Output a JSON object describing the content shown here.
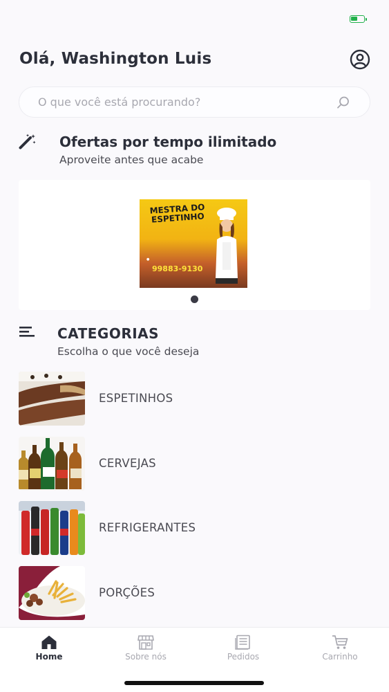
{
  "header": {
    "greeting": "Olá, Washington Luis"
  },
  "search": {
    "placeholder": "O que você está procurando?",
    "value": ""
  },
  "offers": {
    "title": "Ofertas por tempo ilimitado",
    "subtitle": "Aproveite antes que acabe",
    "banner": {
      "brand": "MESTRA DO ESPETINHO",
      "phone": "99883-9130"
    },
    "carousel_index": 1,
    "carousel_total": 1
  },
  "categories": {
    "title": "CATEGORIAS",
    "subtitle": "Escolha o que você deseja",
    "items": [
      {
        "label": "ESPETINHOS",
        "image": "skewers-photo"
      },
      {
        "label": "CERVEJAS",
        "image": "beer-bottles-photo"
      },
      {
        "label": "REFRIGERANTES",
        "image": "soda-bottles-photo"
      },
      {
        "label": "PORÇÕES",
        "image": "fries-platter-photo"
      }
    ]
  },
  "tabs": [
    {
      "label": "Home",
      "icon": "home-icon",
      "active": true
    },
    {
      "label": "Sobre nós",
      "icon": "store-icon",
      "active": false
    },
    {
      "label": "Pedidos",
      "icon": "orders-icon",
      "active": false
    },
    {
      "label": "Carrinho",
      "icon": "cart-icon",
      "active": false
    }
  ],
  "colors": {
    "accent": "#2c2f3a",
    "battery": "#21b14b",
    "inactive": "#a8a8b0"
  }
}
